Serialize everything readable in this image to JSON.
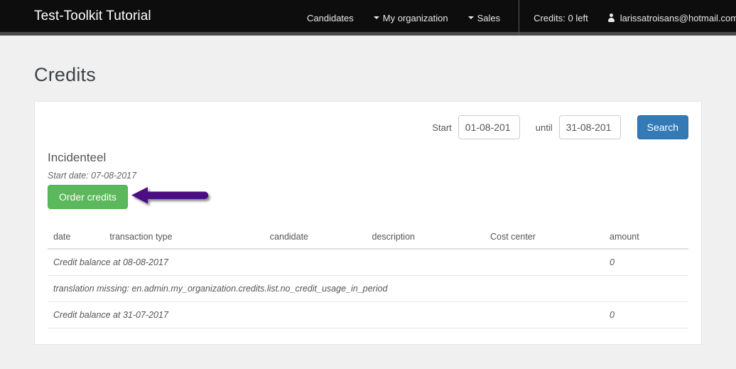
{
  "navbar": {
    "brand": "Test-Toolkit Tutorial",
    "items": [
      {
        "label": "Candidates",
        "caret": false,
        "icon": null
      },
      {
        "label": "My organization",
        "caret": true,
        "icon": "caret-down-icon"
      },
      {
        "label": "Sales",
        "caret": true,
        "icon": "caret-down-icon"
      }
    ],
    "credits_status": "Credits: 0 left",
    "user_email": "larissatroisans@hotmail.com",
    "user_icon": "user-icon",
    "user_caret_icon": "caret-down-icon",
    "background_color": "#0d0d0d",
    "border_color": "#4a4a4a"
  },
  "page": {
    "title": "Credits",
    "background_color": "#f0f0f0"
  },
  "search": {
    "start_label": "Start",
    "start_value": "01-08-201",
    "start_placeholder": "dd-mm-yyyy",
    "until_label": "until",
    "until_value": "31-08-201",
    "until_placeholder": "dd-mm-yyyy",
    "search_button": "Search",
    "search_button_color": "#337ab7"
  },
  "section": {
    "title": "Incidenteel",
    "start_date": "Start date: 07-08-2017",
    "order_button": "Order credits",
    "order_button_color": "#5cb85c"
  },
  "annotation": {
    "type": "arrow-left",
    "color": "#4b0d82",
    "points_to": "order-credits-button"
  },
  "table": {
    "headers": [
      "date",
      "transaction type",
      "candidate",
      "description",
      "Cost center",
      "amount"
    ],
    "rows": [
      {
        "date": "Credit balance at 08-08-2017",
        "transaction_type": "",
        "candidate": "",
        "description": "",
        "cost_center": "",
        "amount": "0",
        "span": false
      },
      {
        "date": "translation missing: en.admin.my_organization.credits.list.no_credit_usage_in_period",
        "transaction_type": "",
        "candidate": "",
        "description": "",
        "cost_center": "",
        "amount": "",
        "span": true
      },
      {
        "date": "Credit balance at 31-07-2017",
        "transaction_type": "",
        "candidate": "",
        "description": "",
        "cost_center": "",
        "amount": "0",
        "span": false
      }
    ]
  }
}
